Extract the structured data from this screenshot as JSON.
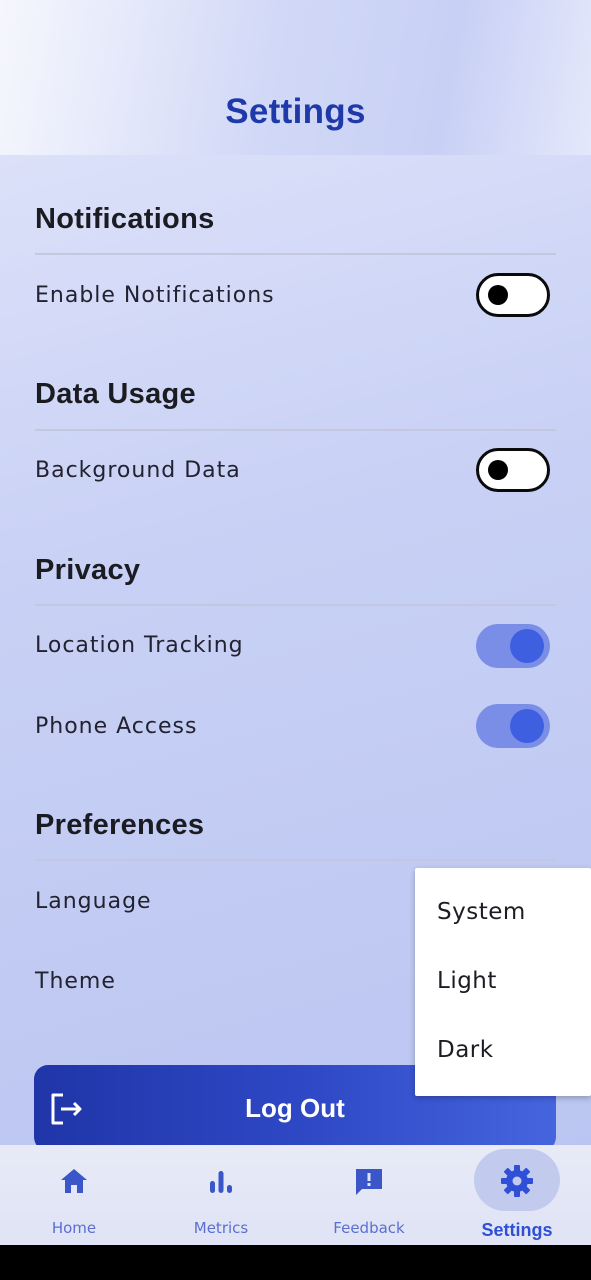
{
  "header": {
    "title": "Settings"
  },
  "sections": {
    "notifications": {
      "title": "Notifications",
      "enable_label": "Enable Notifications",
      "enable_on": false
    },
    "data_usage": {
      "title": "Data Usage",
      "background_label": "Background Data",
      "background_on": false
    },
    "privacy": {
      "title": "Privacy",
      "location_label": "Location Tracking",
      "location_on": true,
      "phone_label": "Phone Access",
      "phone_on": true
    },
    "preferences": {
      "title": "Preferences",
      "language_label": "Language",
      "theme_label": "Theme"
    }
  },
  "theme_dropdown": {
    "options": [
      "System",
      "Light",
      "Dark"
    ]
  },
  "logout": {
    "label": "Log Out",
    "icon": "logout-icon"
  },
  "bottom_nav": {
    "items": [
      {
        "label": "Home",
        "icon": "home-icon"
      },
      {
        "label": "Metrics",
        "icon": "bar-chart-icon"
      },
      {
        "label": "Feedback",
        "icon": "feedback-icon"
      },
      {
        "label": "Settings",
        "icon": "gear-icon"
      }
    ],
    "active": "Settings"
  },
  "colors": {
    "accent": "#1f39a8",
    "toggle_on": "#3d5fe0",
    "toggle_track_on": "#7a8ee8",
    "nav_label": "#5b6fd1"
  }
}
